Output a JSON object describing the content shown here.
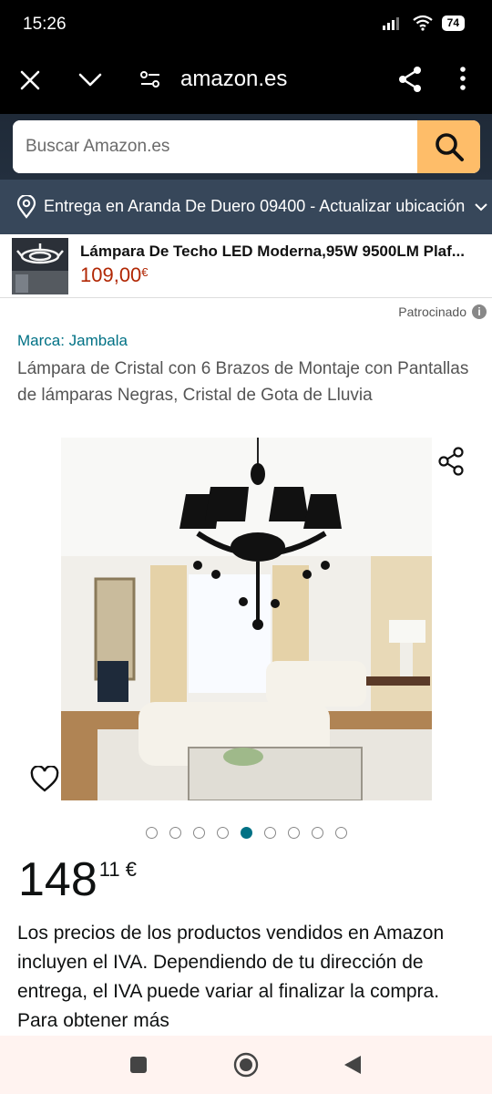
{
  "status": {
    "time": "15:26",
    "battery": "74"
  },
  "browser": {
    "url": "amazon.es"
  },
  "search": {
    "placeholder": "Buscar Amazon.es"
  },
  "delivery": {
    "text": "Entrega en Aranda De Duero 09400 - Actualizar ubicación"
  },
  "sponsored_product": {
    "title": "Lámpara De Techo LED Moderna,95W 9500LM Plaf...",
    "price": "109,00",
    "currency": "€"
  },
  "sponsored_label": "Patrocinado",
  "product": {
    "brand": "Marca: Jambala",
    "title": "Lámpara de Cristal con 6 Brazos de Montaje con Pantallas de lámparas Negras, Cristal de Gota de Lluvia",
    "image_count": 9,
    "active_image_index": 4,
    "price_whole": "148",
    "price_fraction": "11 €",
    "vat_notice": "Los precios de los productos vendidos en Amazon incluyen el IVA. Dependiendo de tu dirección de entrega, el IVA puede variar al finalizar la compra. Para obtener más"
  },
  "colors": {
    "accent": "#007185",
    "price_red": "#b12704",
    "search_button": "#febd69",
    "header": "#232f3e",
    "delivery_bar": "#37475a"
  }
}
